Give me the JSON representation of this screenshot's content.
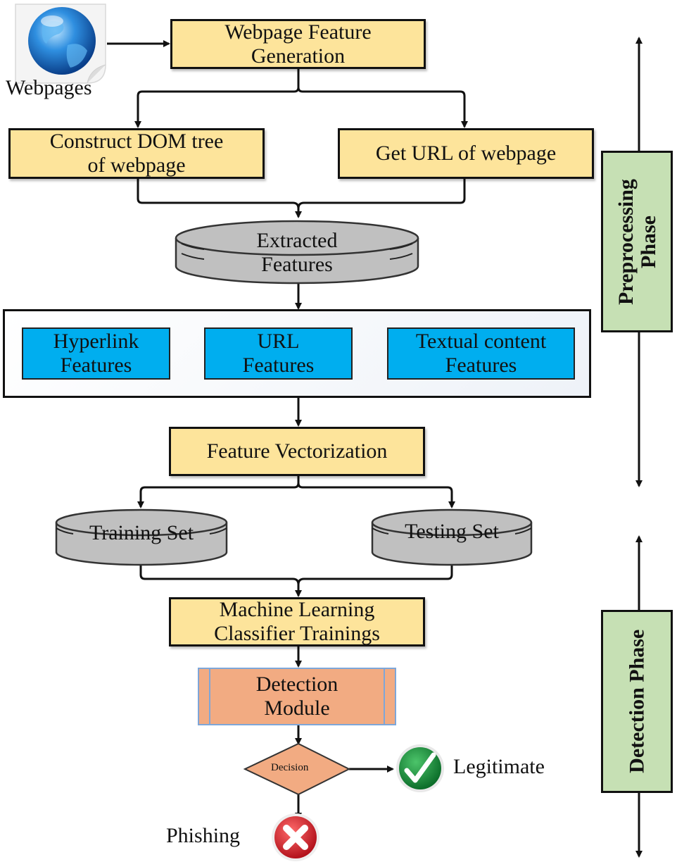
{
  "diagram": {
    "source": {
      "label": "Webpages",
      "icon": "globe-document-icon"
    },
    "nodes": {
      "feature_generation": {
        "line1": "Webpage Feature",
        "line2": "Generation"
      },
      "construct_dom": {
        "line1": "Construct DOM tree",
        "line2": "of webpage"
      },
      "get_url": {
        "label": "Get URL of webpage"
      },
      "extracted_features": {
        "line1": "Extracted",
        "line2": "Features"
      },
      "feature_groups": [
        {
          "line1": "Hyperlink",
          "line2": "Features"
        },
        {
          "line1": "URL",
          "line2": "Features"
        },
        {
          "line1": "Textual content",
          "line2": "Features"
        }
      ],
      "feature_vectorization": {
        "label": "Feature Vectorization"
      },
      "training_set": {
        "label": "Training Set"
      },
      "testing_set": {
        "label": "Testing Set"
      },
      "ml_training": {
        "line1": "Machine Learning",
        "line2": "Classifier Trainings"
      },
      "detection_module": {
        "line1": "Detection",
        "line2": "Module"
      },
      "decision": {
        "label": "Decision"
      }
    },
    "outcomes": {
      "legitimate": {
        "label": "Legitimate",
        "icon": "check-circle-icon",
        "color": "#1a8a3a"
      },
      "phishing": {
        "label": "Phishing",
        "icon": "x-circle-icon",
        "color": "#d0202a"
      }
    },
    "phases": {
      "preprocessing": {
        "line1": "Preprocessing",
        "line2": "Phase"
      },
      "detection": {
        "label": "Detection Phase"
      }
    },
    "colors": {
      "process_fill": "#fde49b",
      "feature_fill": "#00aeef",
      "store_fill": "#c0c0c0",
      "detection_fill": "#f2ab82",
      "phase_fill": "#c6e0b4"
    }
  }
}
